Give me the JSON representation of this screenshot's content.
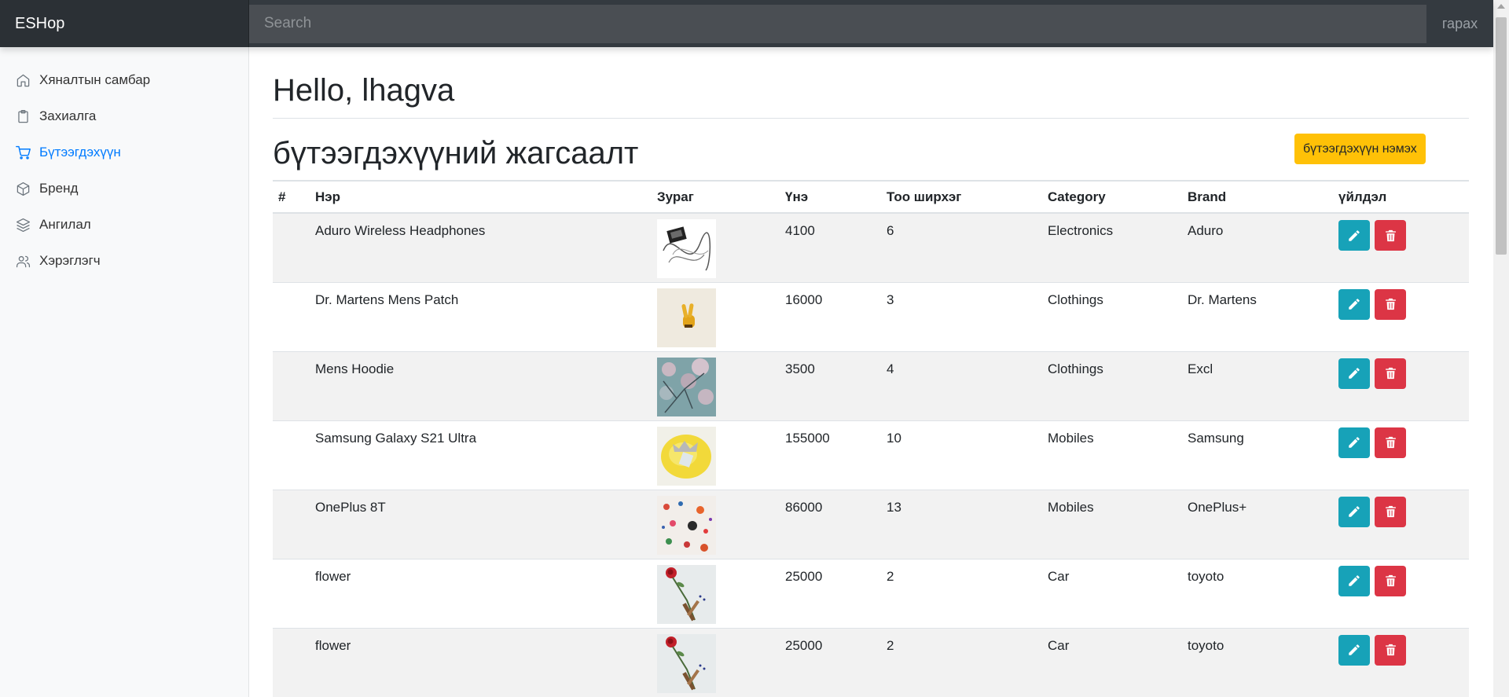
{
  "app": {
    "brand": "ESHop",
    "search_placeholder": "Search",
    "signout": "гарах"
  },
  "sidebar": {
    "items": [
      {
        "label": "Хяналтын самбар",
        "icon": "home-icon",
        "active": false
      },
      {
        "label": "Захиалга",
        "icon": "clipboard-icon",
        "active": false
      },
      {
        "label": "Бүтээгдэхүүн",
        "icon": "cart-icon",
        "active": true
      },
      {
        "label": "Бренд",
        "icon": "box-icon",
        "active": false
      },
      {
        "label": "Ангилал",
        "icon": "layers-icon",
        "active": false
      },
      {
        "label": "Хэрэглэгч",
        "icon": "users-icon",
        "active": false
      }
    ]
  },
  "main": {
    "greeting": "Hello, lhagva",
    "section_title": "бүтээгдэхүүний жагсаалт",
    "add_button": "бүтээгдэхүүн нэмэх",
    "columns": [
      "#",
      "Нэр",
      "Зураг",
      "Үнэ",
      "Тоо ширхэг",
      "Category",
      "Brand",
      "үйлдэл"
    ],
    "rows": [
      {
        "num": "",
        "name": "Aduro Wireless Headphones",
        "image": "headphones-photo",
        "price": "4100",
        "qty": "6",
        "category": "Electronics",
        "brand": "Aduro"
      },
      {
        "num": "",
        "name": "Dr. Martens Mens Patch",
        "image": "peace-hand-photo",
        "price": "16000",
        "qty": "3",
        "category": "Clothings",
        "brand": "Dr. Martens"
      },
      {
        "num": "",
        "name": "Mens Hoodie",
        "image": "blossom-tree-photo",
        "price": "3500",
        "qty": "4",
        "category": "Clothings",
        "brand": "Excl"
      },
      {
        "num": "",
        "name": "Samsung Galaxy S21 Ultra",
        "image": "yellow-paint-photo",
        "price": "155000",
        "qty": "10",
        "category": "Mobiles",
        "brand": "Samsung"
      },
      {
        "num": "",
        "name": "OnePlus 8T",
        "image": "paint-splatter-photo",
        "price": "86000",
        "qty": "13",
        "category": "Mobiles",
        "brand": "OnePlus+"
      },
      {
        "num": "",
        "name": "flower",
        "image": "rose-photo",
        "price": "25000",
        "qty": "2",
        "category": "Car",
        "brand": "toyoto"
      },
      {
        "num": "",
        "name": "flower",
        "image": "rose-photo",
        "price": "25000",
        "qty": "2",
        "category": "Car",
        "brand": "toyoto"
      }
    ]
  },
  "colors": {
    "edit": "#17a2b8",
    "delete": "#dc3545",
    "add": "#ffc107",
    "active_link": "#007bff"
  }
}
